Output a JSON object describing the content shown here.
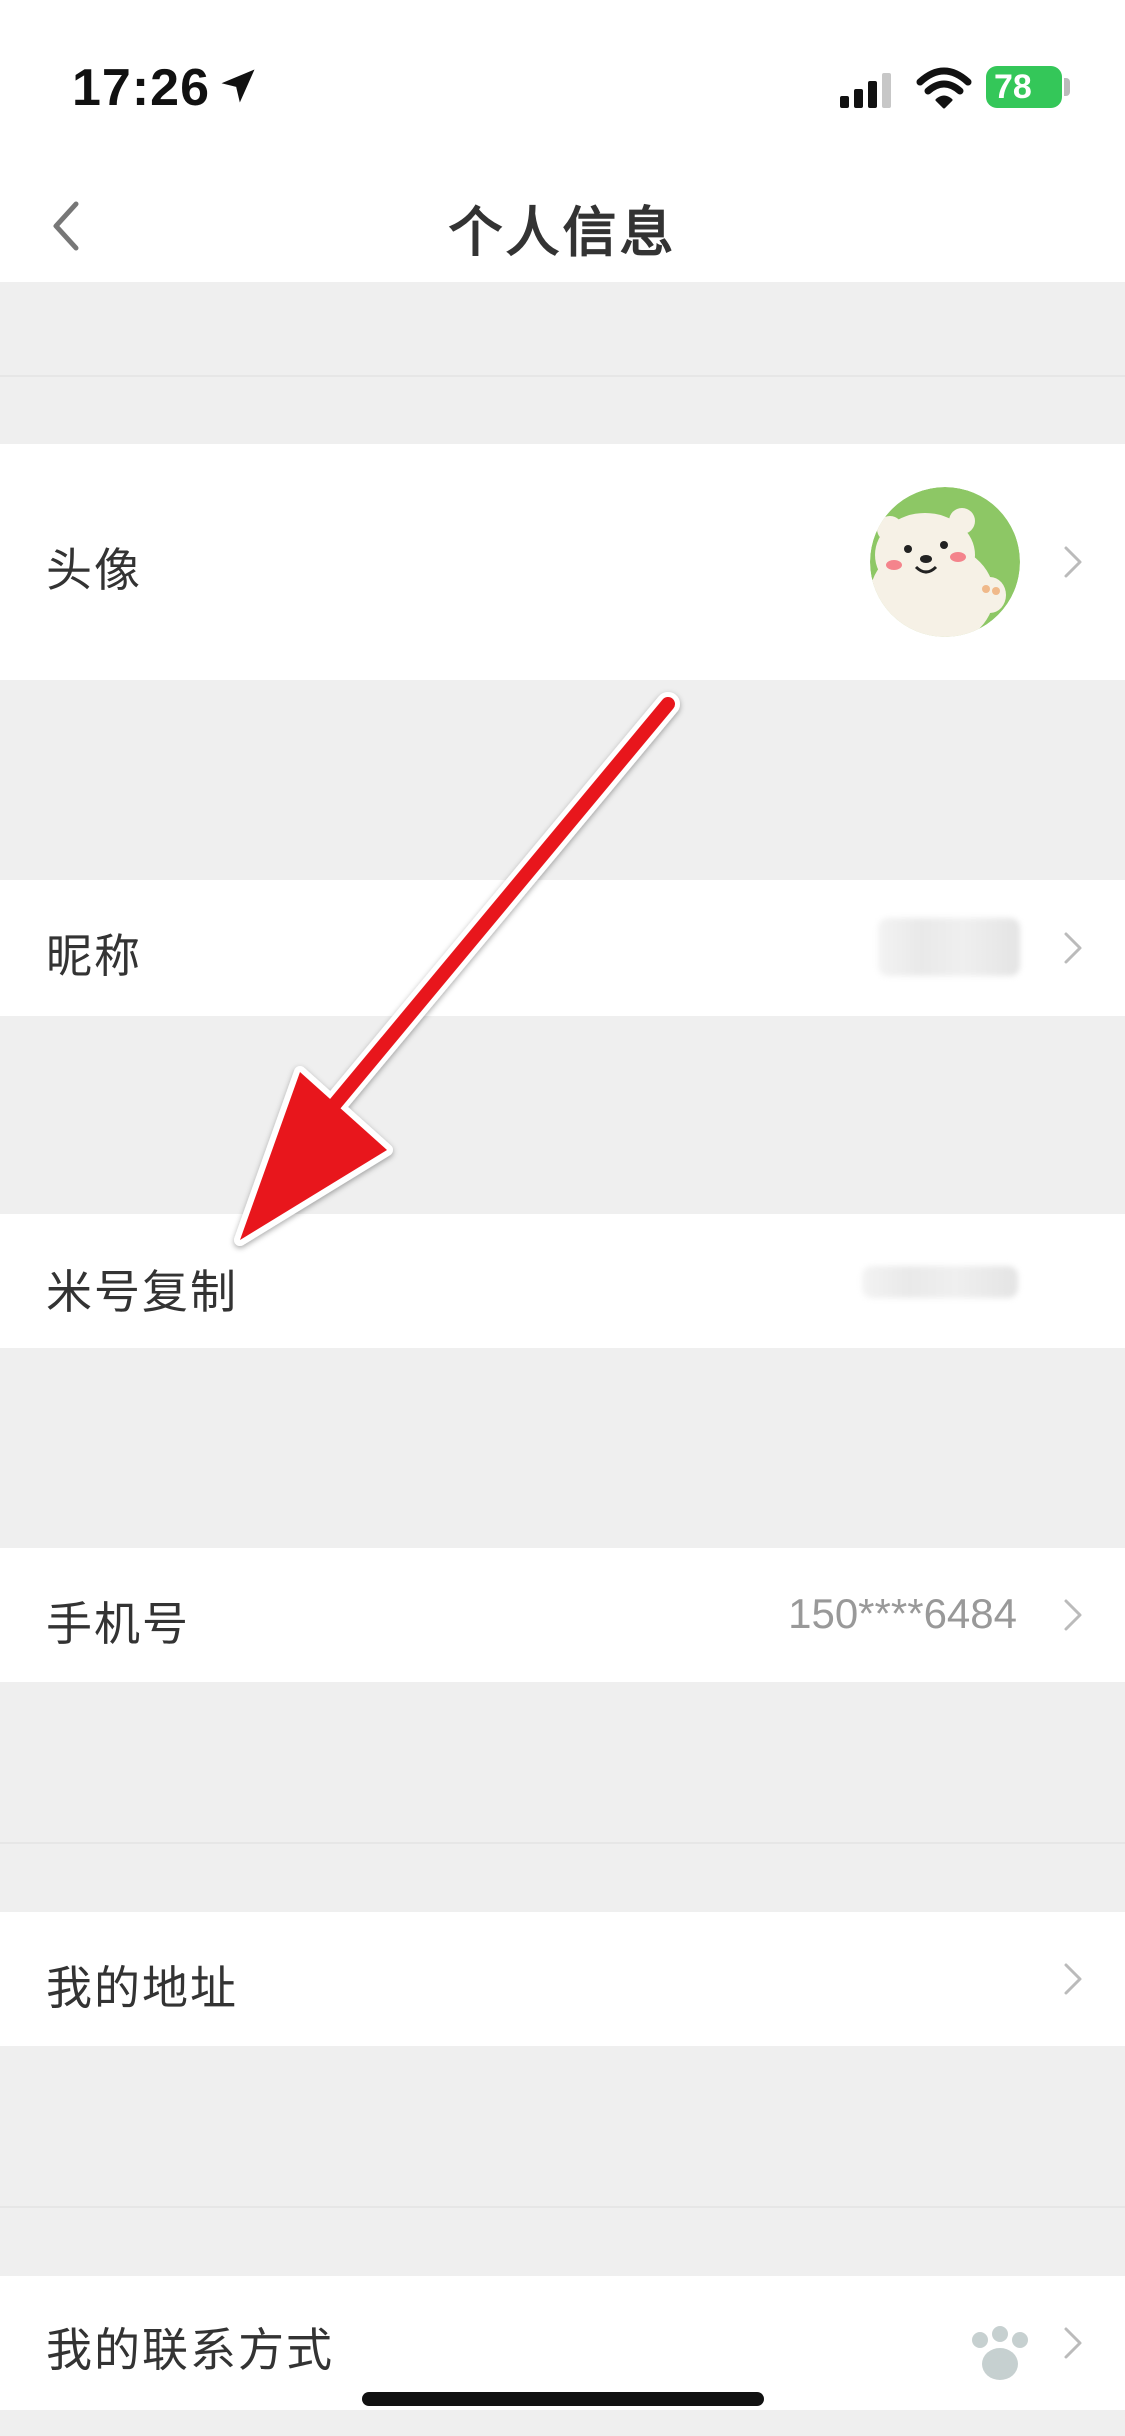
{
  "status_bar": {
    "time": "17:26",
    "battery": "78"
  },
  "nav": {
    "title": "个人信息"
  },
  "rows": {
    "avatar": {
      "label": "头像"
    },
    "nickname": {
      "label": "昵称"
    },
    "mi_id": {
      "label": "米号复制"
    },
    "phone": {
      "label": "手机号",
      "value": "150****6484"
    },
    "address": {
      "label": "我的地址"
    },
    "contact": {
      "label": "我的联系方式"
    }
  },
  "colors": {
    "accent_arrow": "#e8141c",
    "battery_green": "#34c759",
    "avatar_bg": "#8dc765"
  },
  "icons": [
    "location-arrow-icon",
    "signal-icon",
    "wifi-icon",
    "battery-icon",
    "back-chevron-icon",
    "chevron-right-icon"
  ]
}
